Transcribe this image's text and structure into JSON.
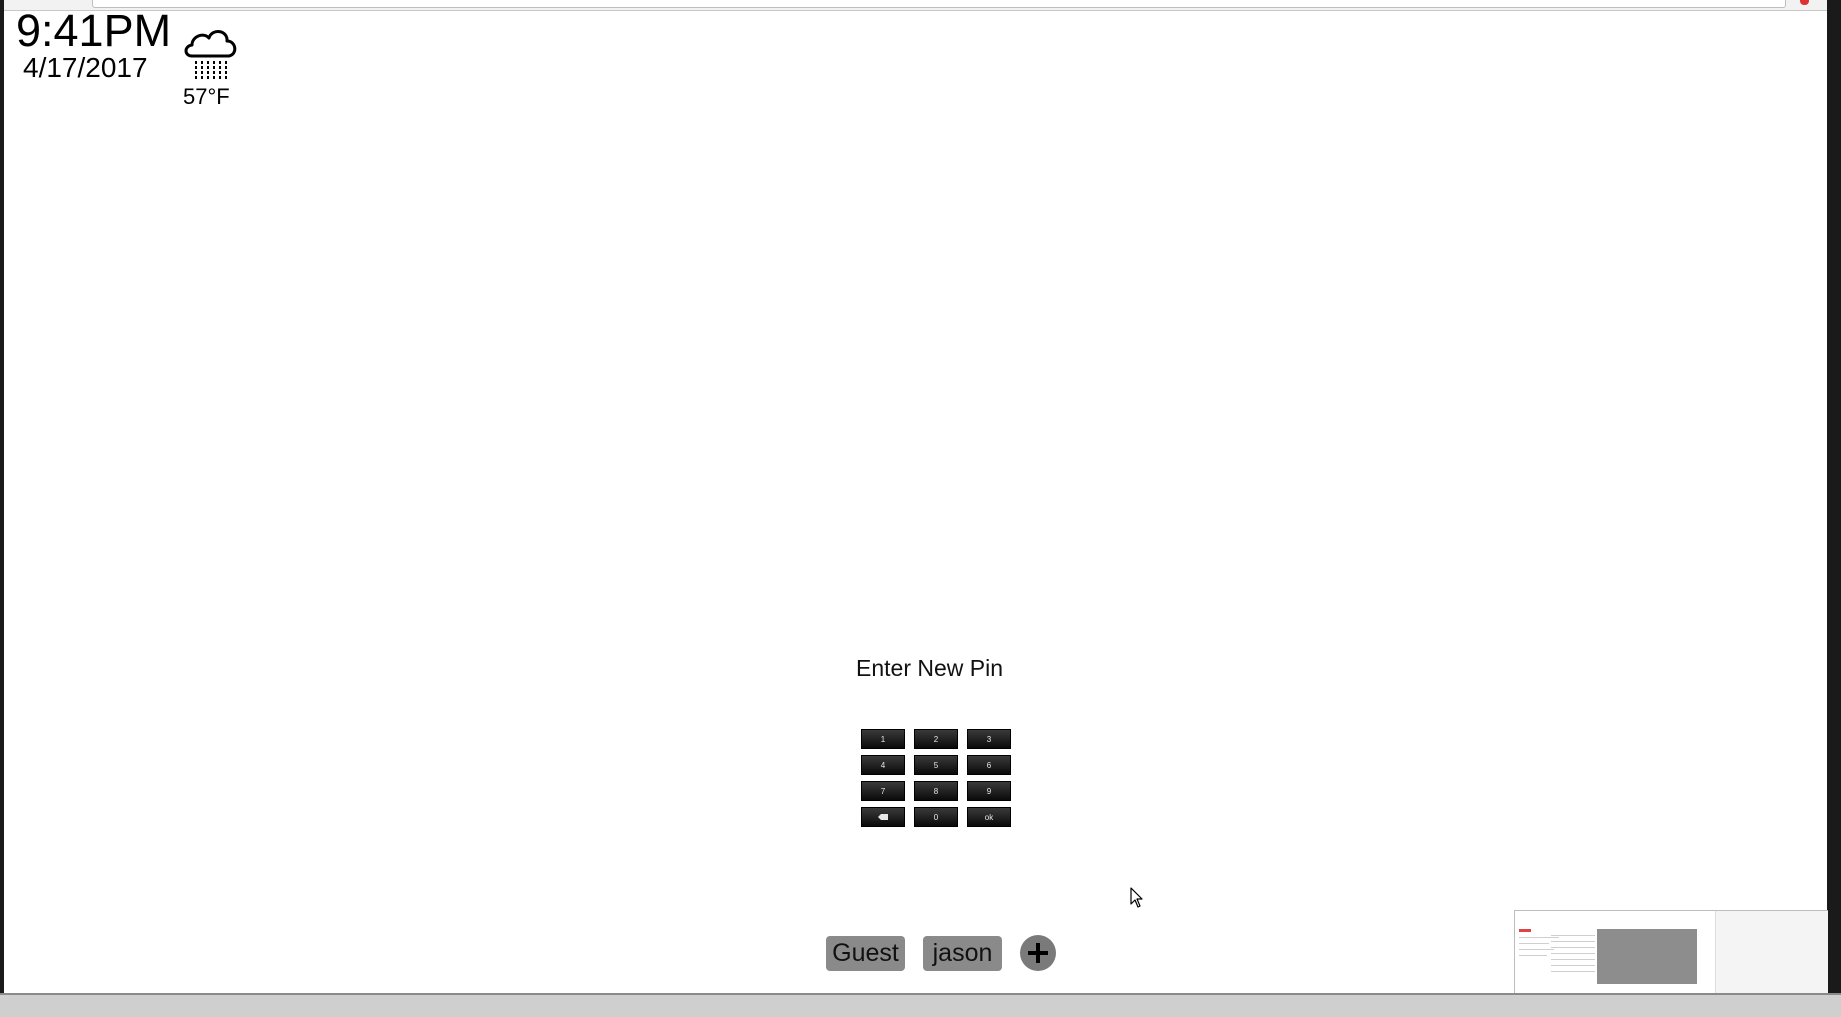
{
  "clock": {
    "time": "9:41PM",
    "date": "4/17/2017"
  },
  "weather": {
    "icon": "rain-cloud-icon",
    "temperature": "57°F"
  },
  "pin_entry": {
    "title": "Enter New Pin",
    "keys": [
      "1",
      "2",
      "3",
      "4",
      "5",
      "6",
      "7",
      "8",
      "9",
      "⌫",
      "0",
      "ok"
    ]
  },
  "users": {
    "guest_label": "Guest",
    "jason_label": "jason",
    "add_icon": "plus-icon"
  },
  "colors": {
    "key_background": "#1a1a1a",
    "user_button": "#8a8a8a",
    "add_button": "#7a7a7a"
  }
}
